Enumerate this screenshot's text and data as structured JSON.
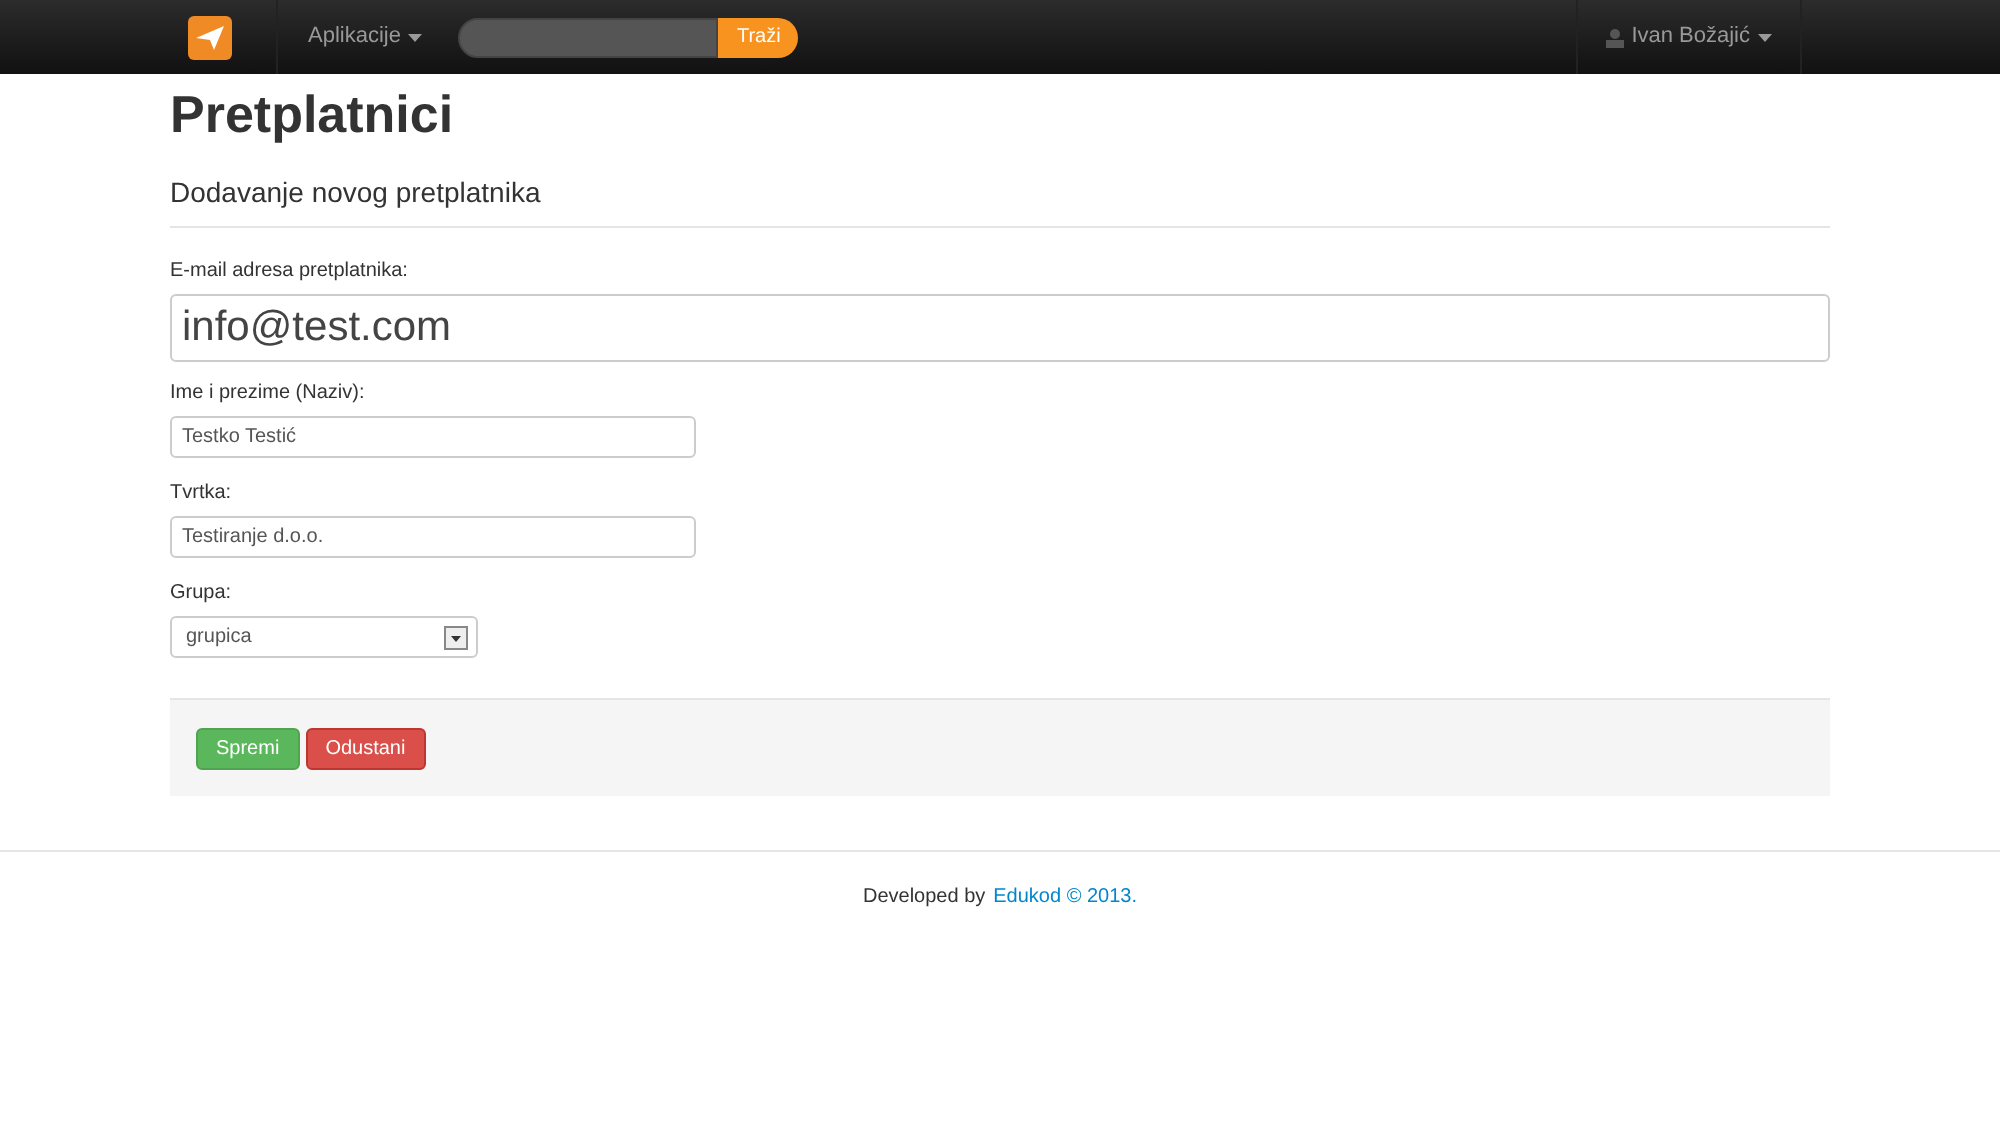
{
  "navbar": {
    "menu": "Aplikacije",
    "search": {
      "button": "Traži"
    },
    "user": "Ivan Božajić"
  },
  "page": {
    "title": "Pretplatnici",
    "subtitle": "Dodavanje novog pretplatnika"
  },
  "form": {
    "fields": [
      {
        "kind": "large",
        "label": "E-mail adresa pretplatnika:",
        "value": "info@test.com"
      },
      {
        "kind": "text",
        "label": "Ime i prezime (Naziv):",
        "value": "Testko Testić"
      },
      {
        "kind": "text",
        "label": "Tvrtka:",
        "value": "Testiranje d.o.o."
      },
      {
        "kind": "select",
        "label": "Grupa:",
        "value": "grupica"
      }
    ],
    "buttons": [
      {
        "kind": "primary",
        "label": "Spremi"
      },
      {
        "kind": "danger",
        "label": "Odustani"
      }
    ]
  },
  "footer": {
    "text": "Developed by",
    "link": "Edukod © 2013."
  }
}
